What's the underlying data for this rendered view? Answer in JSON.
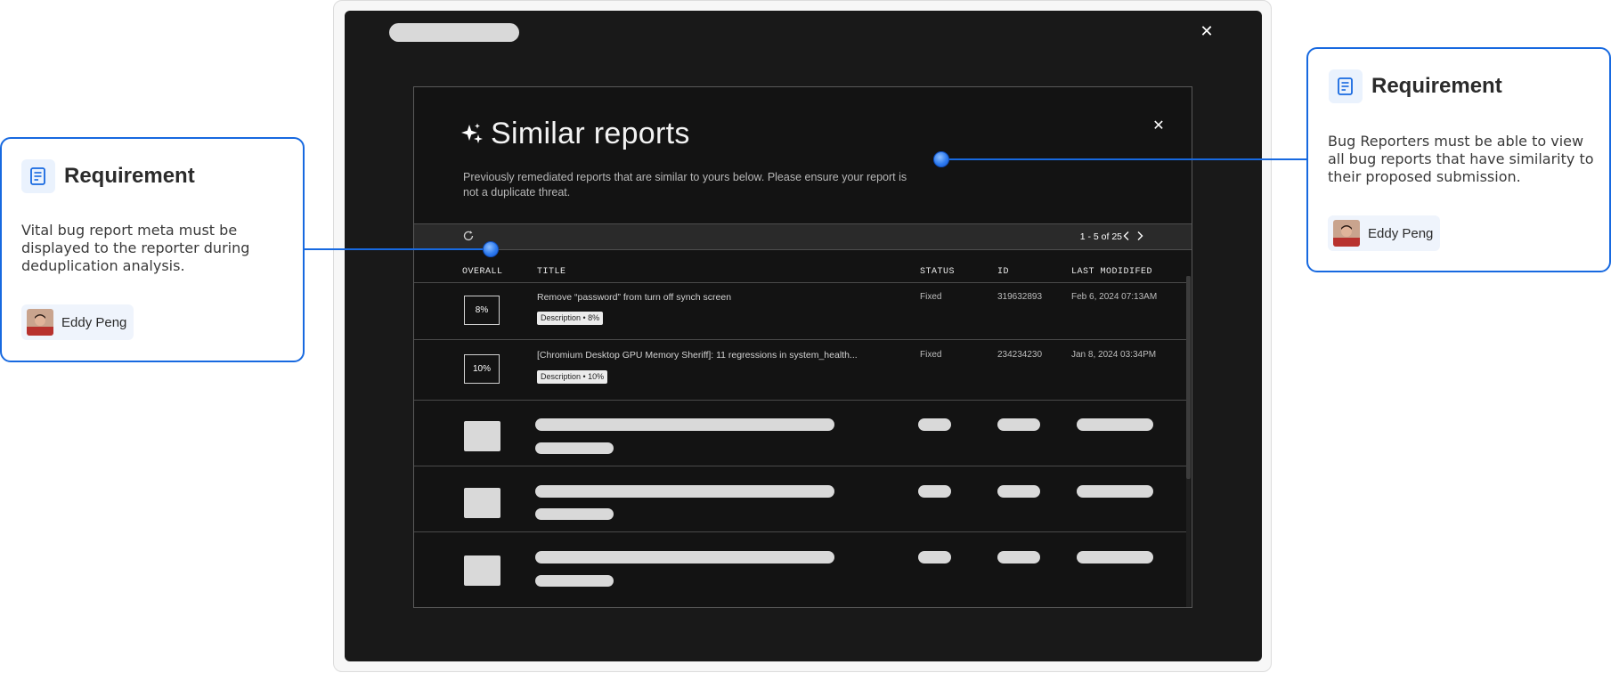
{
  "modal": {
    "title": "Similar reports",
    "description": "Previously remediated reports that are similar to yours below. Please ensure your report is not a duplicate threat.",
    "pagination": "1 - 5 of 25"
  },
  "table": {
    "columns": [
      "OVERALL",
      "TITLE",
      "STATUS",
      "ID",
      "LAST MODIDIFED"
    ],
    "rows": [
      {
        "overall": "8%",
        "title": "Remove “password” from turn off synch screen",
        "badge": "Description • 8%",
        "status": "Fixed",
        "id": "319632893",
        "modified": "Feb 6, 2024 07:13AM"
      },
      {
        "overall": "10%",
        "title": "[Chromium Desktop GPU Memory Sheriff]: 11 regressions in system_health...",
        "badge": "Description • 10%",
        "status": "Fixed",
        "id": "234234230",
        "modified": "Jan 8, 2024 03:34PM"
      }
    ]
  },
  "annotations": {
    "left": {
      "heading": "Requirement",
      "text": "Vital bug report meta must be displayed to the reporter during deduplication analysis.",
      "user": "Eddy Peng"
    },
    "right": {
      "heading": "Requirement",
      "text": "Bug Reporters must be able to view all bug reports that have similarity to their proposed submission.",
      "user": "Eddy Peng"
    }
  },
  "colors": {
    "accent": "#1769e0",
    "screen_bg": "#191919",
    "modal_bg": "#131313",
    "skeleton": "#d9d9d9"
  },
  "icons": [
    "sparkle-icon",
    "close-icon",
    "refresh-icon",
    "chevron-left-icon",
    "chevron-right-icon",
    "note-icon",
    "avatar"
  ]
}
